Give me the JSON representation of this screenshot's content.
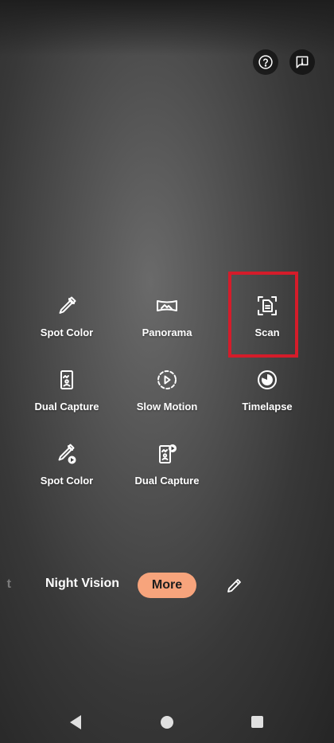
{
  "top_bar": {
    "help_icon": "help-circle-icon",
    "feedback_icon": "feedback-icon"
  },
  "modes": [
    {
      "label": "Spot Color",
      "icon": "eyedropper-icon"
    },
    {
      "label": "Panorama",
      "icon": "panorama-icon"
    },
    {
      "label": "Scan",
      "icon": "document-scan-icon"
    },
    {
      "label": "Dual Capture",
      "icon": "dual-capture-icon"
    },
    {
      "label": "Slow Motion",
      "icon": "slow-motion-icon"
    },
    {
      "label": "Timelapse",
      "icon": "timelapse-icon"
    },
    {
      "label": "Spot Color",
      "icon": "eyedropper-video-icon"
    },
    {
      "label": "Dual Capture",
      "icon": "dual-capture-video-icon"
    }
  ],
  "mode_bar": {
    "previous_mode_fragment": "t",
    "current_mode": "Night Vision",
    "more_label": "More",
    "edit_icon": "pencil-icon"
  },
  "colors": {
    "more_button": "#f7a47c",
    "highlight": "#d41c2a"
  },
  "nav": {
    "back_icon": "back-triangle-icon",
    "home_icon": "home-circle-icon",
    "recents_icon": "recents-square-icon"
  }
}
